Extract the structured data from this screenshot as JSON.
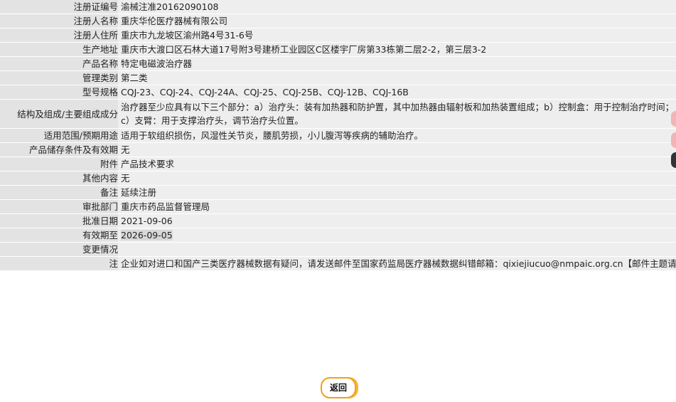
{
  "rows": [
    {
      "label": "注册证编号",
      "value": "渝械注准20162090108"
    },
    {
      "label": "注册人名称",
      "value": "重庆华伦医疗器械有限公司"
    },
    {
      "label": "注册人住所",
      "value": "重庆市九龙坡区渝州路4号31-6号"
    },
    {
      "label": "生产地址",
      "value": "重庆市大渡口区石林大道17号附3号建桥工业园区C区楼宇厂房第33栋第二层2-2，第三层3-2"
    },
    {
      "label": "产品名称",
      "value": "特定电磁波治疗器"
    },
    {
      "label": "管理类别",
      "value": "第二类"
    },
    {
      "label": "型号规格",
      "value": "CQJ-23、CQJ-24、CQJ-24A、CQJ-25、CQJ-25B、CQJ-12B、CQJ-16B"
    },
    {
      "label": "结构及组成/主要组成成分",
      "value": "治疗器至少应具有以下三个部分：a）治疗头：装有加热器和防护置，其中加热器由辐射板和加热装置组成；b）控制盒：用于控制治疗时间；c）支臂：用于支撑治疗头，调节治疗头位置。"
    },
    {
      "label": "适用范围/预期用途",
      "value": "适用于软组织损伤，风湿性关节炎，腰肌劳损，小儿腹泻等疾病的辅助治疗。"
    },
    {
      "label": "产品储存条件及有效期",
      "value": "无"
    },
    {
      "label": "附件",
      "value": "产品技术要求"
    },
    {
      "label": "其他内容",
      "value": "无"
    },
    {
      "label": "备注",
      "value": "延续注册"
    },
    {
      "label": "审批部门",
      "value": "重庆市药品监督管理局"
    },
    {
      "label": "批准日期",
      "value": "2021-09-06"
    },
    {
      "label": "有效期至",
      "value": "2026-09-05"
    },
    {
      "label": "变更情况",
      "value": ""
    }
  ],
  "note": {
    "label": "注",
    "text": "企业如对进口和国产三类医疗器械数据有疑问，请发送邮件至国家药监局医疗器械数据纠错邮箱：qixiejiucuo@nmpaic.org.cn【邮件主题请注明“医疗器械数据问题”，邮件正文中请准确填写以下全部信息：1.医疗器械注册证号/备案号；2.类型（注册、变更、延续等）；3.问题描述（500字以内）；4.企业名称（全称）；5.统一社会信用代码；6.联系人姓名；7.联系电话（手机和座机）；8.联系邮箱】，或致电国家药监局医疗器械数据纠错电话010-88331514（此电话为我局医疗器械数据纠错联系电话，并非相应产品/企业业务咨询电话）。企业如对国产一类和二类医疗器械数据有疑问，请咨询国家局信息中心，电话010-88332877，88331520（工作日），也可通过发邮件与我们联系：邮件地址yaopinshuju@nmpaic.org.cn，邮件主题请注明“国产医疗器械产品（注册）-数据（注册证号/备案号）数据问题”。国产一类和二类医疗器械数据来源于省局，由省局通过数据共享平台进行纠错和维护。"
  },
  "back_button": {
    "label": "返回"
  },
  "colors": {
    "label_bg": "#e3e3e3",
    "value_bg": "#eeeeee",
    "button_ring": "#f0a020"
  }
}
